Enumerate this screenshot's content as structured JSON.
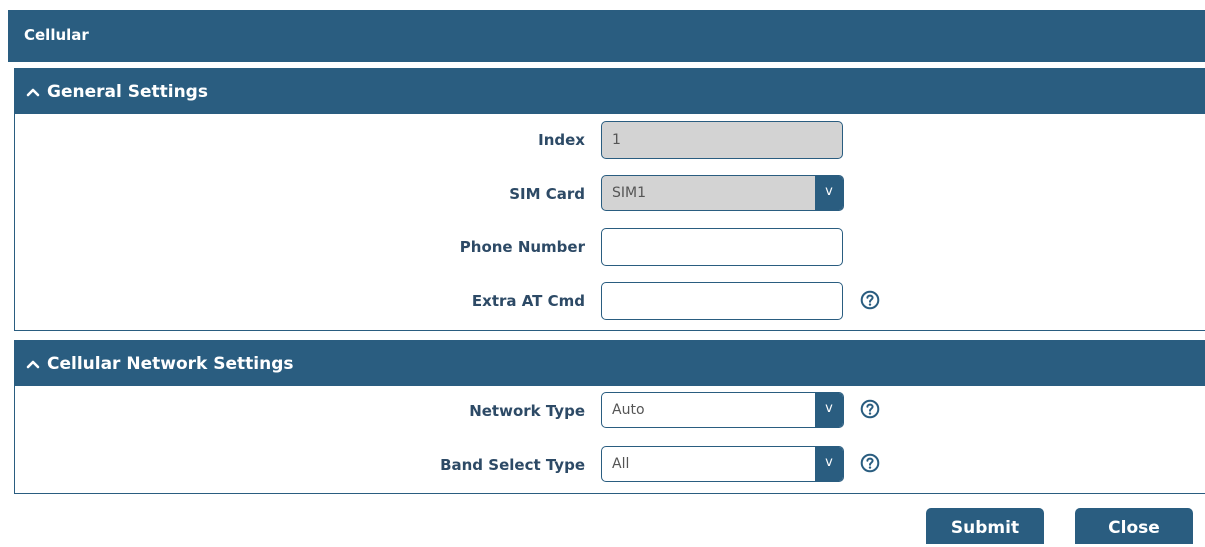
{
  "page": {
    "title": "Cellular"
  },
  "general": {
    "title": "General Settings",
    "index": {
      "label": "Index",
      "value": "1"
    },
    "sim_card": {
      "label": "SIM Card",
      "value": "SIM1"
    },
    "phone_number": {
      "label": "Phone Number",
      "value": ""
    },
    "extra_at_cmd": {
      "label": "Extra AT Cmd",
      "value": ""
    }
  },
  "network": {
    "title": "Cellular Network Settings",
    "network_type": {
      "label": "Network Type",
      "value": "Auto"
    },
    "band_select_type": {
      "label": "Band Select Type",
      "value": "All"
    }
  },
  "select_arrow": "v",
  "buttons": {
    "submit": "Submit",
    "close": "Close"
  },
  "colors": {
    "primary": "#2a5d80",
    "disabled_bg": "#d3d3d3",
    "label": "#2d4a66"
  },
  "icons": {
    "section_toggle": "chevron-up-icon",
    "help": "question-circle-icon"
  }
}
